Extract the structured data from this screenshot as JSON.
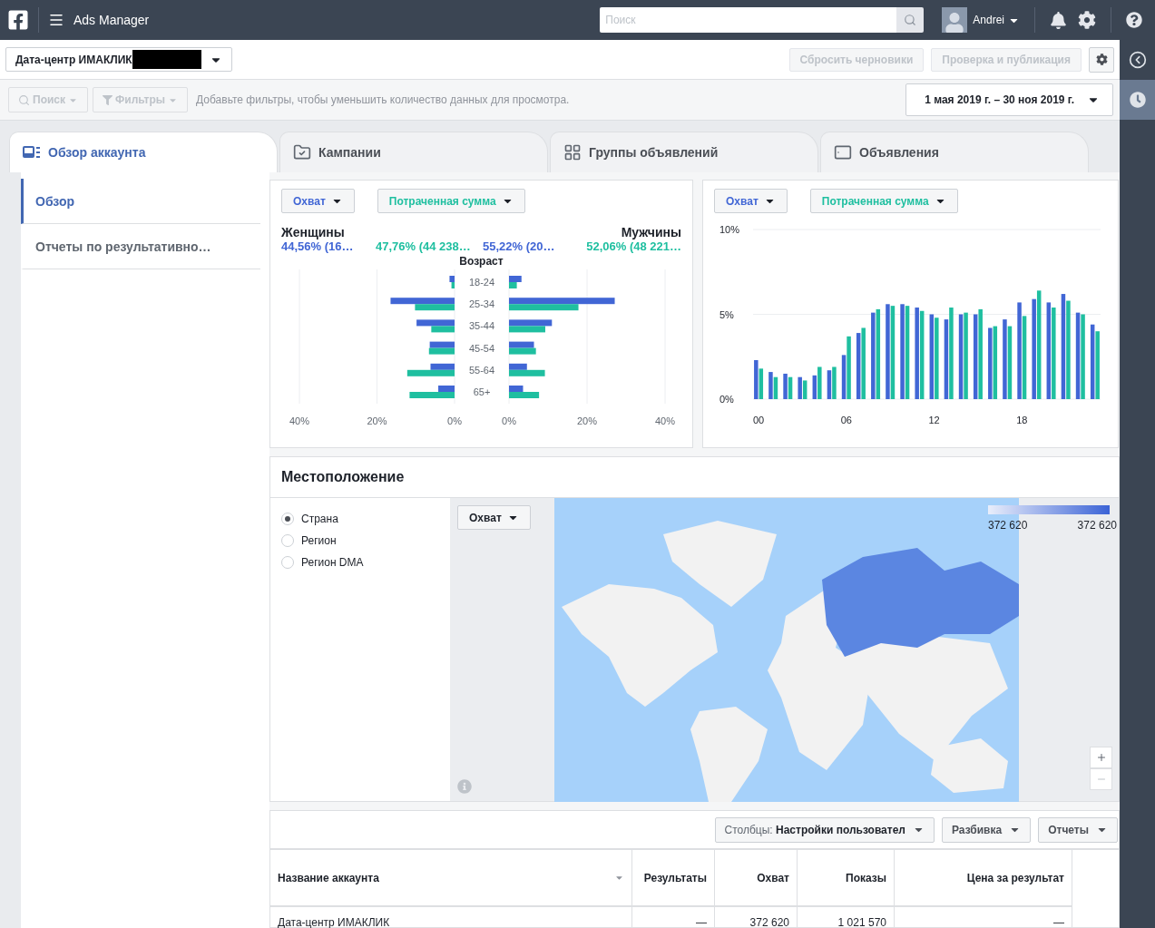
{
  "topbar": {
    "app_title": "Ads Manager",
    "search": {
      "placeholder": "Поиск"
    },
    "user": "Andrei"
  },
  "account_bar": {
    "account": "Дата-центр ИМАКЛИК",
    "buttons": [
      {
        "label": "Сбросить черновики",
        "disabled": true
      },
      {
        "label": "Проверка и публикация",
        "disabled": true
      }
    ]
  },
  "filter_bar": {
    "search": {
      "label": "Поиск",
      "disabled": true
    },
    "filters": {
      "label": "Фильтры",
      "disabled": true
    },
    "hint": "Добавьте фильтры, чтобы уменьшить количество данных для просмотра.",
    "date_range": "1 мая 2019 г. – 30 ноя 2019 г."
  },
  "tabs": [
    {
      "label": "Обзор аккаунта",
      "kind": "account",
      "selected": true
    },
    {
      "label": "Кампании",
      "kind": "campaigns",
      "selected": false
    },
    {
      "label": "Группы объявлений",
      "kind": "adsets",
      "selected": false
    },
    {
      "label": "Объявления",
      "kind": "ads",
      "selected": false
    }
  ],
  "sidebar": {
    "items": [
      {
        "label": "Обзор",
        "selected": true
      },
      {
        "label": "Отчеты по результативно…",
        "selected": false
      }
    ]
  },
  "demographics": {
    "women": {
      "title": "Женщины",
      "reach": "44,56% (16…",
      "spend": "47,76% (44 238…",
      "chart_data": {
        "type": "bar",
        "orientation": "horizontal",
        "ylabel": "Возраст",
        "categories": [
          "18-24",
          "25-34",
          "35-44",
          "45-54",
          "55-64",
          "65+"
        ],
        "series": [
          {
            "name": "Охват",
            "color": "#4166d5",
            "values": [
              1.3,
              16.5,
              9.8,
              6.4,
              6.2,
              4.2
            ]
          },
          {
            "name": "Потраченная сумма",
            "color": "#1fbfa0",
            "values": [
              0.8,
              10.2,
              6.0,
              6.6,
              12.2,
              11.6
            ]
          }
        ],
        "xlim": [
          40,
          0
        ],
        "xticks": [
          {
            "value": 40,
            "label": "40%"
          },
          {
            "value": 20,
            "label": "20%"
          },
          {
            "value": 0,
            "label": "0%"
          }
        ]
      }
    },
    "men": {
      "title": "Мужчины",
      "reach": "55,22% (20…",
      "spend": "52,06% (48 221…",
      "chart_data": {
        "type": "bar",
        "orientation": "horizontal",
        "series": [
          {
            "color": "#4166d5",
            "values": [
              3.2,
              27.1,
              11.0,
              6.4,
              4.6,
              3.6
            ]
          },
          {
            "color": "#1fbfa0",
            "values": [
              2.0,
              17.8,
              9.3,
              6.9,
              9.2,
              7.7
            ]
          }
        ],
        "xlim": [
          0,
          40
        ],
        "xticks": [
          {
            "value": 0,
            "label": "0%"
          },
          {
            "value": 20,
            "label": "20%"
          },
          {
            "value": 40,
            "label": "40%"
          }
        ]
      }
    }
  },
  "hourly": {
    "chart_data": {
      "type": "bar",
      "x": [
        0,
        1,
        2,
        3,
        4,
        5,
        6,
        7,
        8,
        9,
        10,
        11,
        12,
        13,
        14,
        15,
        16,
        17,
        18,
        19,
        20,
        21,
        22,
        23
      ],
      "series": [
        {
          "name": "Охват",
          "color": "#4166d5",
          "values": [
            2.3,
            1.6,
            1.5,
            1.3,
            1.4,
            1.7,
            2.6,
            3.9,
            5.1,
            5.6,
            5.6,
            5.4,
            5.0,
            4.7,
            5.0,
            5.0,
            4.2,
            4.7,
            5.7,
            5.9,
            5.7,
            6.2,
            5.1,
            4.4
          ]
        },
        {
          "name": "Потраченная сумма",
          "color": "#1fbfa0",
          "values": [
            1.8,
            1.3,
            1.3,
            1.1,
            1.9,
            1.9,
            3.7,
            4.2,
            5.3,
            5.5,
            5.5,
            5.2,
            4.8,
            5.4,
            5.1,
            5.3,
            4.3,
            4.3,
            4.9,
            6.4,
            5.4,
            5.8,
            5.0,
            4.0
          ]
        }
      ],
      "xlim": [
        -0.5,
        23.5
      ],
      "ylim": [
        0,
        10
      ],
      "xticks": [
        {
          "value": 0,
          "label": "00"
        },
        {
          "value": 6,
          "label": "06"
        },
        {
          "value": 12,
          "label": "12"
        },
        {
          "value": 18,
          "label": "18"
        }
      ],
      "yticks": [
        {
          "value": 0,
          "label": "0%"
        },
        {
          "value": 5,
          "label": "5%"
        },
        {
          "value": 10,
          "label": "10%"
        }
      ]
    }
  },
  "location": {
    "title": "Местоположение",
    "options": [
      {
        "label": "Страна",
        "selected": true
      },
      {
        "label": "Регион",
        "selected": false
      },
      {
        "label": "Регион DMA",
        "selected": false
      }
    ],
    "metric": "Охват",
    "legend": {
      "min": "372 620",
      "max": "372 620"
    }
  },
  "table": {
    "toolbar": {
      "columns": "Столбцы: **Настройки пользовател**",
      "breakdown": "Разбивка",
      "reports": "Отчеты"
    },
    "columns": [
      "Название аккаунта",
      "Результаты",
      "Охват",
      "Показы",
      "Цена за результат"
    ],
    "rows": [
      [
        "Дата-центр ИМАКЛИК",
        "—",
        "372 620",
        "1 021 570",
        "—"
      ]
    ]
  }
}
